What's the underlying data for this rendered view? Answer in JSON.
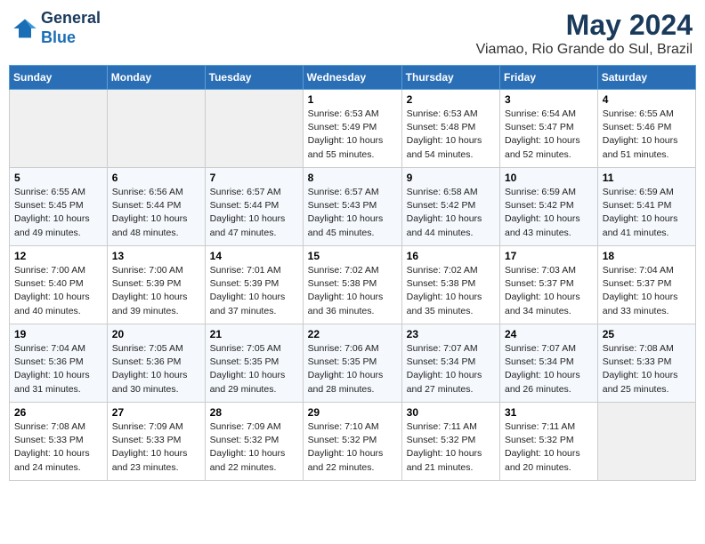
{
  "header": {
    "logo_line1": "General",
    "logo_line2": "Blue",
    "month": "May 2024",
    "location": "Viamao, Rio Grande do Sul, Brazil"
  },
  "weekdays": [
    "Sunday",
    "Monday",
    "Tuesday",
    "Wednesday",
    "Thursday",
    "Friday",
    "Saturday"
  ],
  "weeks": [
    [
      {
        "day": "",
        "info": ""
      },
      {
        "day": "",
        "info": ""
      },
      {
        "day": "",
        "info": ""
      },
      {
        "day": "1",
        "info": "Sunrise: 6:53 AM\nSunset: 5:49 PM\nDaylight: 10 hours\nand 55 minutes."
      },
      {
        "day": "2",
        "info": "Sunrise: 6:53 AM\nSunset: 5:48 PM\nDaylight: 10 hours\nand 54 minutes."
      },
      {
        "day": "3",
        "info": "Sunrise: 6:54 AM\nSunset: 5:47 PM\nDaylight: 10 hours\nand 52 minutes."
      },
      {
        "day": "4",
        "info": "Sunrise: 6:55 AM\nSunset: 5:46 PM\nDaylight: 10 hours\nand 51 minutes."
      }
    ],
    [
      {
        "day": "5",
        "info": "Sunrise: 6:55 AM\nSunset: 5:45 PM\nDaylight: 10 hours\nand 49 minutes."
      },
      {
        "day": "6",
        "info": "Sunrise: 6:56 AM\nSunset: 5:44 PM\nDaylight: 10 hours\nand 48 minutes."
      },
      {
        "day": "7",
        "info": "Sunrise: 6:57 AM\nSunset: 5:44 PM\nDaylight: 10 hours\nand 47 minutes."
      },
      {
        "day": "8",
        "info": "Sunrise: 6:57 AM\nSunset: 5:43 PM\nDaylight: 10 hours\nand 45 minutes."
      },
      {
        "day": "9",
        "info": "Sunrise: 6:58 AM\nSunset: 5:42 PM\nDaylight: 10 hours\nand 44 minutes."
      },
      {
        "day": "10",
        "info": "Sunrise: 6:59 AM\nSunset: 5:42 PM\nDaylight: 10 hours\nand 43 minutes."
      },
      {
        "day": "11",
        "info": "Sunrise: 6:59 AM\nSunset: 5:41 PM\nDaylight: 10 hours\nand 41 minutes."
      }
    ],
    [
      {
        "day": "12",
        "info": "Sunrise: 7:00 AM\nSunset: 5:40 PM\nDaylight: 10 hours\nand 40 minutes."
      },
      {
        "day": "13",
        "info": "Sunrise: 7:00 AM\nSunset: 5:39 PM\nDaylight: 10 hours\nand 39 minutes."
      },
      {
        "day": "14",
        "info": "Sunrise: 7:01 AM\nSunset: 5:39 PM\nDaylight: 10 hours\nand 37 minutes."
      },
      {
        "day": "15",
        "info": "Sunrise: 7:02 AM\nSunset: 5:38 PM\nDaylight: 10 hours\nand 36 minutes."
      },
      {
        "day": "16",
        "info": "Sunrise: 7:02 AM\nSunset: 5:38 PM\nDaylight: 10 hours\nand 35 minutes."
      },
      {
        "day": "17",
        "info": "Sunrise: 7:03 AM\nSunset: 5:37 PM\nDaylight: 10 hours\nand 34 minutes."
      },
      {
        "day": "18",
        "info": "Sunrise: 7:04 AM\nSunset: 5:37 PM\nDaylight: 10 hours\nand 33 minutes."
      }
    ],
    [
      {
        "day": "19",
        "info": "Sunrise: 7:04 AM\nSunset: 5:36 PM\nDaylight: 10 hours\nand 31 minutes."
      },
      {
        "day": "20",
        "info": "Sunrise: 7:05 AM\nSunset: 5:36 PM\nDaylight: 10 hours\nand 30 minutes."
      },
      {
        "day": "21",
        "info": "Sunrise: 7:05 AM\nSunset: 5:35 PM\nDaylight: 10 hours\nand 29 minutes."
      },
      {
        "day": "22",
        "info": "Sunrise: 7:06 AM\nSunset: 5:35 PM\nDaylight: 10 hours\nand 28 minutes."
      },
      {
        "day": "23",
        "info": "Sunrise: 7:07 AM\nSunset: 5:34 PM\nDaylight: 10 hours\nand 27 minutes."
      },
      {
        "day": "24",
        "info": "Sunrise: 7:07 AM\nSunset: 5:34 PM\nDaylight: 10 hours\nand 26 minutes."
      },
      {
        "day": "25",
        "info": "Sunrise: 7:08 AM\nSunset: 5:33 PM\nDaylight: 10 hours\nand 25 minutes."
      }
    ],
    [
      {
        "day": "26",
        "info": "Sunrise: 7:08 AM\nSunset: 5:33 PM\nDaylight: 10 hours\nand 24 minutes."
      },
      {
        "day": "27",
        "info": "Sunrise: 7:09 AM\nSunset: 5:33 PM\nDaylight: 10 hours\nand 23 minutes."
      },
      {
        "day": "28",
        "info": "Sunrise: 7:09 AM\nSunset: 5:32 PM\nDaylight: 10 hours\nand 22 minutes."
      },
      {
        "day": "29",
        "info": "Sunrise: 7:10 AM\nSunset: 5:32 PM\nDaylight: 10 hours\nand 22 minutes."
      },
      {
        "day": "30",
        "info": "Sunrise: 7:11 AM\nSunset: 5:32 PM\nDaylight: 10 hours\nand 21 minutes."
      },
      {
        "day": "31",
        "info": "Sunrise: 7:11 AM\nSunset: 5:32 PM\nDaylight: 10 hours\nand 20 minutes."
      },
      {
        "day": "",
        "info": ""
      }
    ]
  ]
}
